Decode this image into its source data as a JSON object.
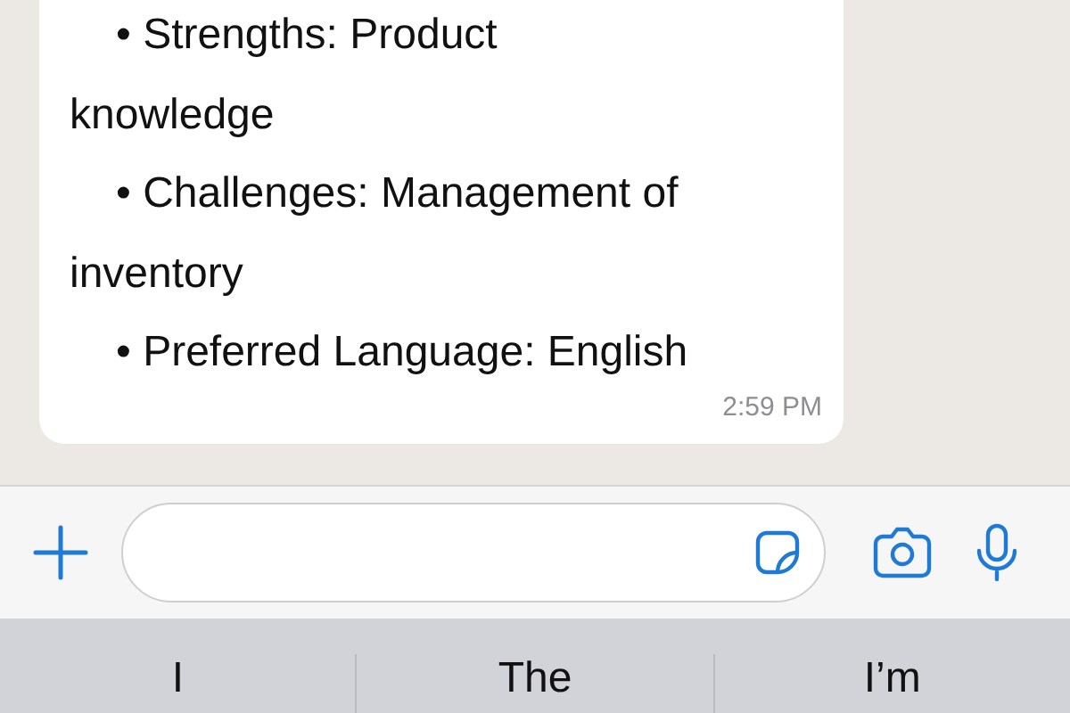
{
  "message": {
    "items": [
      {
        "text": "• Strengths: Product knowledge"
      },
      {
        "text": "• Challenges: Management of inventory"
      },
      {
        "text": "• Preferred Language: English"
      }
    ],
    "time": "2:59 PM"
  },
  "suggestions": [
    {
      "label": "I"
    },
    {
      "label": "The"
    },
    {
      "label": "I’m"
    }
  ]
}
